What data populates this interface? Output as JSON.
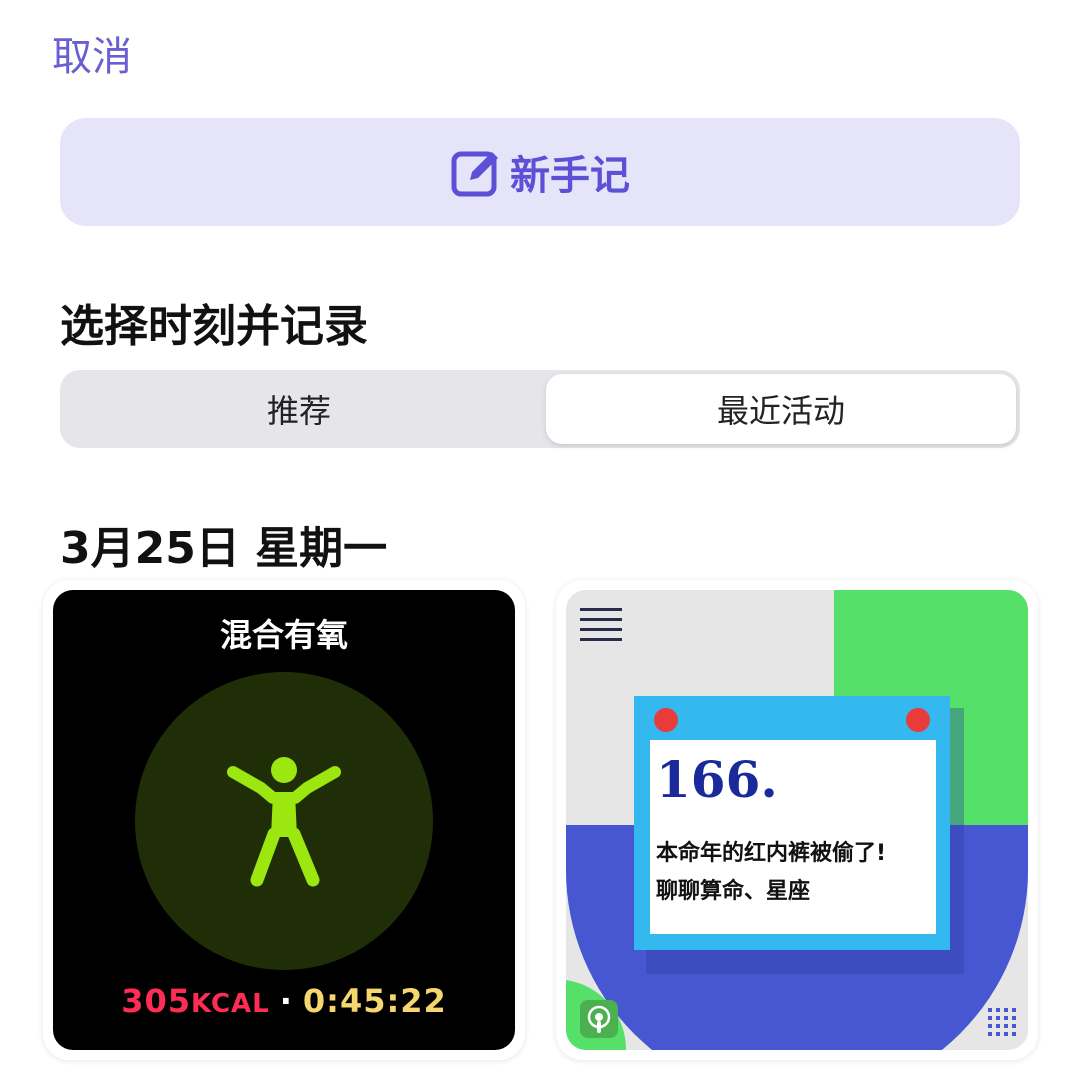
{
  "header": {
    "cancel_label": "取消"
  },
  "new_note": {
    "label": "新手记",
    "icon": "compose-icon"
  },
  "section": {
    "title": "选择时刻并记录"
  },
  "tabs": [
    {
      "label": "推荐",
      "selected": false
    },
    {
      "label": "最近活动",
      "selected": true
    }
  ],
  "date_heading": "3月25日 星期一",
  "cards": {
    "workout": {
      "title": "混合有氧",
      "kcal_value": "305",
      "kcal_unit": "KCAL",
      "separator": "·",
      "duration": "0:45:22",
      "icon": "mixed-cardio-figure-icon"
    },
    "podcast": {
      "episode_number": "166.",
      "line1": "本命年的红内裤被偷了!",
      "line2": "聊聊算命、星座",
      "icons": [
        "menu-lines-icon",
        "podcasts-app-icon",
        "grid-dots-icon"
      ]
    }
  },
  "colors": {
    "accent": "#5b50d6",
    "accent_bg": "#e6e4f8",
    "kcal": "#ff2d55",
    "duration": "#f5d76e",
    "figure": "#9be70f"
  }
}
